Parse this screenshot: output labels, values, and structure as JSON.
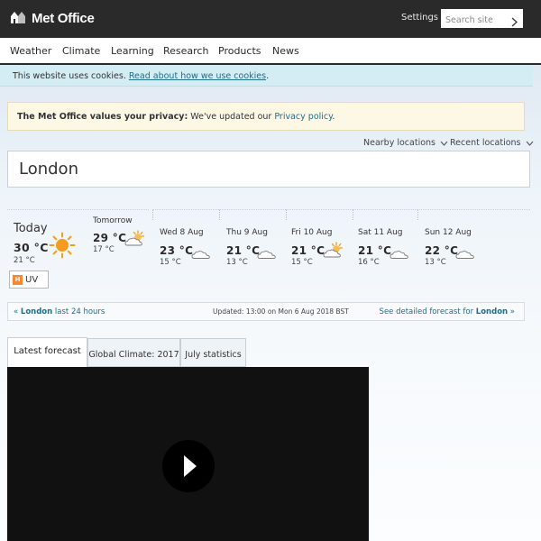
{
  "header": {
    "logo_text": "Met Office",
    "settings_label": "Settings",
    "search_placeholder": "Search site"
  },
  "nav": {
    "items": [
      "Weather",
      "Climate",
      "Learning",
      "Research",
      "Products",
      "News"
    ]
  },
  "cookie_banner": {
    "text": "This website uses cookies.",
    "link": "Read about how we use cookies"
  },
  "privacy_notice": {
    "bold": "The Met Office values your privacy:",
    "text": "We've updated our",
    "link": "Privacy policy"
  },
  "location_links": {
    "nearby": "Nearby locations",
    "recent": "Recent locations"
  },
  "location": {
    "value": "London"
  },
  "forecast": {
    "days": [
      {
        "name": "Today",
        "high": "30 °C",
        "low": "21 °C",
        "icon": "sun-icon"
      },
      {
        "name": "Tomorrow",
        "high": "29 °C",
        "low": "17 °C",
        "icon": "sunny-intervals-icon"
      },
      {
        "name": "Wed 8 Aug",
        "high": "23 °C",
        "low": "15 °C",
        "icon": "cloud-icon"
      },
      {
        "name": "Thu 9 Aug",
        "high": "21 °C",
        "low": "13 °C",
        "icon": "cloud-icon"
      },
      {
        "name": "Fri 10 Aug",
        "high": "21 °C",
        "low": "15 °C",
        "icon": "sunny-intervals-icon"
      },
      {
        "name": "Sat 11 Aug",
        "high": "21 °C",
        "low": "16 °C",
        "icon": "cloud-icon"
      },
      {
        "name": "Sun 12 Aug",
        "high": "22 °C",
        "low": "13 °C",
        "icon": "cloud-icon"
      }
    ],
    "uv_badge": "H",
    "uv_label": "UV",
    "last24_prefix": "«",
    "last24_location": "London",
    "last24_text": "last 24 hours",
    "updated": "Updated: 13:00 on Mon 6 Aug 2018 BST",
    "detailed_text": "See detailed forecast for",
    "detailed_location": "London",
    "detailed_suffix": "»"
  },
  "tabs": [
    "Latest forecast",
    "Global Climate: 2017",
    "July statistics"
  ],
  "colors": {
    "header_bg": "#2a2a2a",
    "link": "#1c6f86",
    "cookie_bg": "#d4ecf3",
    "privacy_bg": "#fdf8e6",
    "sun": "#f39c1e",
    "uv_badge": "#ef8a3a"
  }
}
